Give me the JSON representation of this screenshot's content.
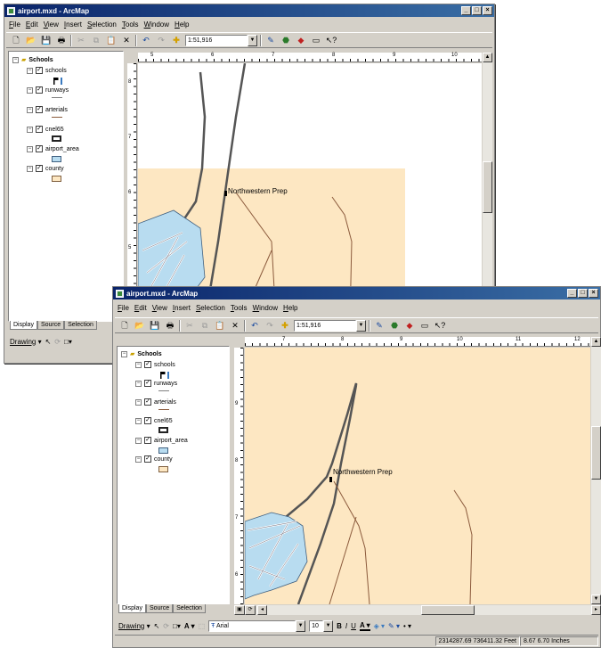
{
  "back_window": {
    "title": "airport.mxd - ArcMap",
    "menu": [
      "File",
      "Edit",
      "View",
      "Insert",
      "Selection",
      "Tools",
      "Window",
      "Help"
    ],
    "scale": "1:51,916",
    "toc": {
      "group": "Schools",
      "layers": [
        "schools",
        "runways",
        "arterials",
        "cnel65",
        "airport_area",
        "county"
      ]
    },
    "tabs": [
      "Display",
      "Source",
      "Selection"
    ],
    "drawing_label": "Drawing",
    "ruler_ticks": [
      "5",
      "6",
      "7",
      "8",
      "9",
      "10"
    ],
    "vruler_ticks": [
      "8",
      "7",
      "6",
      "5"
    ],
    "map_label": "Northwestern Prep"
  },
  "front_window": {
    "title": "airport.mxd - ArcMap",
    "menu": [
      "File",
      "Edit",
      "View",
      "Insert",
      "Selection",
      "Tools",
      "Window",
      "Help"
    ],
    "scale": "1:51,916",
    "toc": {
      "group": "Schools",
      "layers": [
        "schools",
        "runways",
        "arterials",
        "cnel65",
        "airport_area",
        "county"
      ]
    },
    "tabs": [
      "Display",
      "Source",
      "Selection"
    ],
    "drawing_label": "Drawing",
    "font_name": "Arial",
    "font_size": "10",
    "ruler_ticks": [
      "7",
      "8",
      "9",
      "10",
      "11",
      "12"
    ],
    "vruler_ticks": [
      "9",
      "8",
      "7",
      "6"
    ],
    "map_label": "Northwestern Prep",
    "status_coords": "2314287.69  736411.32 Feet",
    "status_page": "8.67  6.70 Inches"
  },
  "colors": {
    "title_start": "#0a246a",
    "title_end": "#3a6ea5",
    "county_fill": "#fde7c2",
    "airport_fill": "#b8dcf0",
    "arterial": "#8b5a3c",
    "cnel": "#4a4a4a"
  }
}
